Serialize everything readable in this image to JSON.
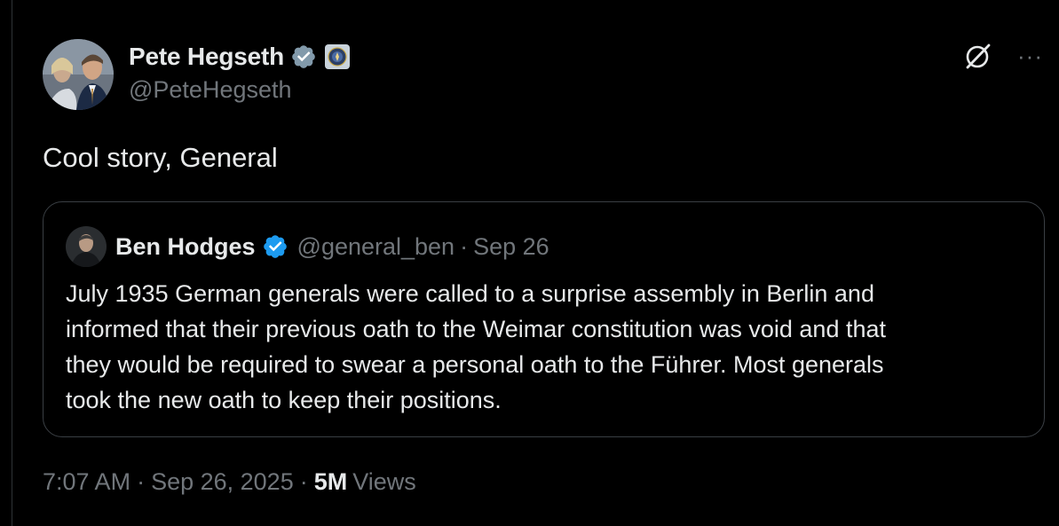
{
  "tweet": {
    "author": {
      "display_name": "Pete Hegseth",
      "handle": "@PeteHegseth",
      "verified": true,
      "affiliation_badge": "dod-seal-icon"
    },
    "text": "Cool story, General",
    "actions": {
      "grok_icon": "grok-icon",
      "more_icon": "more-options-icon",
      "more_glyph": "···"
    },
    "quoted": {
      "display_name": "Ben Hodges",
      "handle": "@general_ben",
      "separator": "·",
      "date": "Sep 26",
      "verified": true,
      "body_lines": [
        "July 1935 German generals were called to a surprise assembly in Berlin and",
        "informed that their previous oath to the Weimar constitution was void and that",
        "they would be required to swear a personal oath to the Führer. Most generals",
        "took the new oath to keep their positions."
      ]
    },
    "meta": {
      "time": "7:07 AM",
      "separator": "·",
      "date": "Sep 26, 2025",
      "views_count": "5M",
      "views_label": "Views"
    }
  },
  "colors": {
    "background": "#000000",
    "text_primary": "#e7e9ea",
    "text_secondary": "#71767b",
    "verified_blue": "#1d9bf0",
    "verified_gray": "#829aab",
    "border": "#3a3f44"
  }
}
